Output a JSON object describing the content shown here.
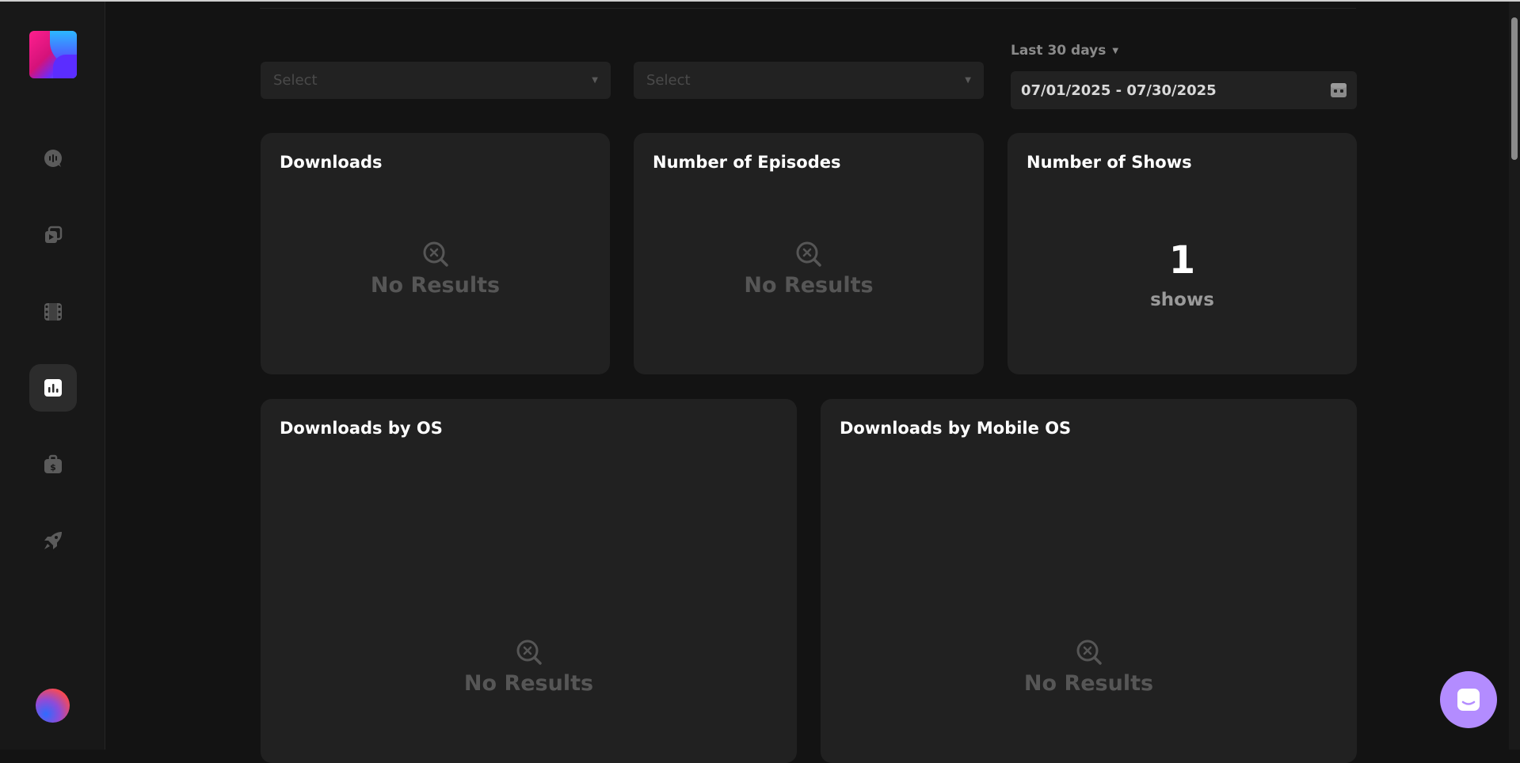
{
  "sidebar": {
    "items": [
      {
        "icon": "podcast-icon",
        "active": false
      },
      {
        "icon": "episodes-icon",
        "active": false
      },
      {
        "icon": "film-icon",
        "active": false
      },
      {
        "icon": "analytics-icon",
        "active": true
      },
      {
        "icon": "monetization-icon",
        "active": false
      },
      {
        "icon": "rocket-icon",
        "active": false
      }
    ],
    "avatar": "user-avatar"
  },
  "filters": {
    "select_1": {
      "placeholder": "Select"
    },
    "select_2": {
      "placeholder": "Select"
    },
    "date_range": {
      "preset_label": "Last 30 days",
      "value": "07/01/2025 - 07/30/2025"
    }
  },
  "cards": {
    "downloads": {
      "title": "Downloads",
      "empty_text": "No Results"
    },
    "episodes": {
      "title": "Number of Episodes",
      "empty_text": "No Results"
    },
    "shows": {
      "title": "Number of Shows",
      "value": "1",
      "unit": "shows"
    },
    "downloads_by_os": {
      "title": "Downloads by OS",
      "empty_text": "No Results"
    },
    "downloads_by_mobile_os": {
      "title": "Downloads by Mobile OS",
      "empty_text": "No Results"
    }
  },
  "colors": {
    "background": "#131313",
    "sidebar": "#181818",
    "card": "#212121",
    "muted_text": "#565656",
    "chat_accent": "#b38cff"
  }
}
